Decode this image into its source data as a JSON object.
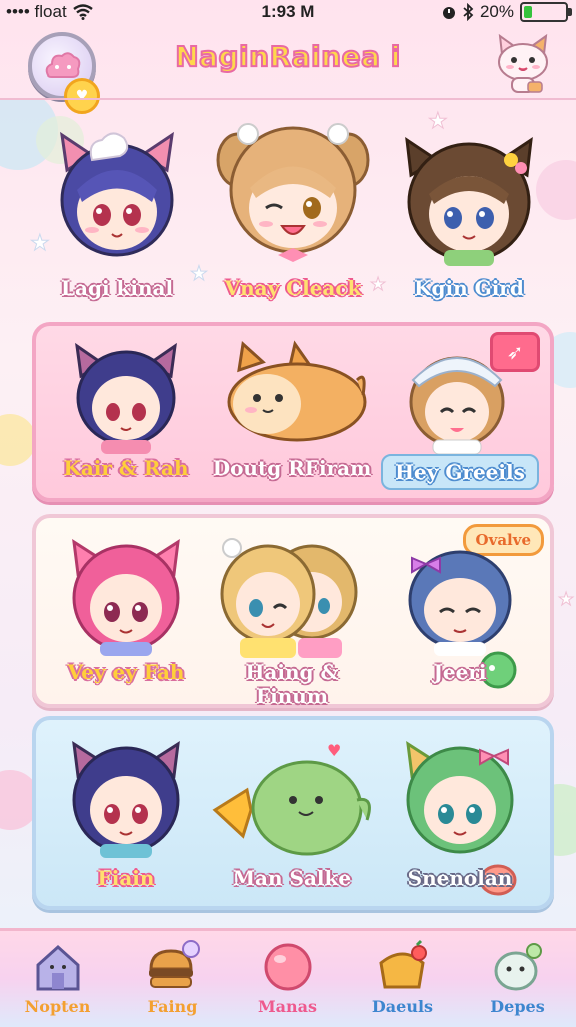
{
  "status_bar": {
    "carrier": "•••• float",
    "time": "1:93 M",
    "battery": "20%",
    "battery_level": 0.2
  },
  "header": {
    "title": "NaginRainea i"
  },
  "rows": [
    {
      "style": "bare",
      "cells": [
        {
          "label": "Lagi kinal",
          "character": "purple-hair-cat-girl"
        },
        {
          "label": "Vnay Cleack",
          "character": "blonde-girl-winking"
        },
        {
          "label": "Kgin Gird",
          "character": "brown-hair-cat-girl"
        }
      ]
    },
    {
      "style": "pink",
      "cells": [
        {
          "label": "Kair & Rah",
          "character": "purple-hair-cat-girl"
        },
        {
          "label": "Doutg RFiram",
          "character": "orange-shiba-pet"
        },
        {
          "label": "Hey Greeils",
          "character": "blonde-girl-beanie",
          "pill": true
        }
      ]
    },
    {
      "style": "cream",
      "tag": "Ovalve",
      "cells": [
        {
          "label": "Vey ey Fah",
          "character": "pink-hair-cat-girl"
        },
        {
          "label": "Haing & Finum",
          "character": "blonde-twins"
        },
        {
          "label": "Jeeri",
          "character": "blue-hair-girl-bow"
        }
      ]
    },
    {
      "style": "blue",
      "cells": [
        {
          "label": "Fiain",
          "character": "purple-hair-cat-girl"
        },
        {
          "label": "Man Salke",
          "character": "green-slime-pet"
        },
        {
          "label": "Snenolan",
          "character": "green-hair-cat-girl"
        }
      ]
    }
  ],
  "nav": [
    {
      "label": "Nopten",
      "icon": "house-icon"
    },
    {
      "label": "Faing",
      "icon": "burger-icon"
    },
    {
      "label": "Manas",
      "icon": "pink-bubble-icon"
    },
    {
      "label": "Daeuls",
      "icon": "dessert-icon"
    },
    {
      "label": "Depes",
      "icon": "slime-icon"
    }
  ],
  "colors": {
    "accent_pink": "#f3a6c4",
    "title_fill": "#ffd84c",
    "title_stroke": "#e86aa4"
  }
}
